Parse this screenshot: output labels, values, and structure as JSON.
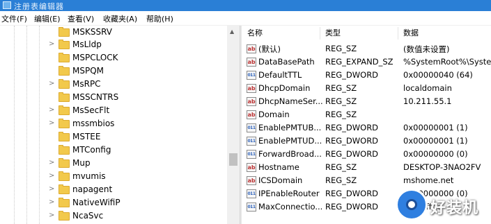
{
  "window": {
    "title": "注册表编辑器"
  },
  "menu": [
    "文件(F)",
    "编辑(E)",
    "查看(V)",
    "收藏夹(A)",
    "帮助(H)"
  ],
  "tree": [
    {
      "label": "MSKSSRV",
      "expandable": false
    },
    {
      "label": "MsLldp",
      "expandable": true
    },
    {
      "label": "MSPCLOCK",
      "expandable": false
    },
    {
      "label": "MSPQM",
      "expandable": false
    },
    {
      "label": "MsRPC",
      "expandable": true
    },
    {
      "label": "MSSCNTRS",
      "expandable": false
    },
    {
      "label": "MsSecFlt",
      "expandable": true
    },
    {
      "label": "mssmbios",
      "expandable": true
    },
    {
      "label": "MSTEE",
      "expandable": false
    },
    {
      "label": "MTConfig",
      "expandable": false
    },
    {
      "label": "Mup",
      "expandable": true
    },
    {
      "label": "mvumis",
      "expandable": true
    },
    {
      "label": "napagent",
      "expandable": true
    },
    {
      "label": "NativeWifiP",
      "expandable": true
    },
    {
      "label": "NcaSvc",
      "expandable": true
    }
  ],
  "list": {
    "columns": [
      "名称",
      "类型",
      "数据"
    ],
    "rows": [
      {
        "icon": "string-value-icon",
        "name": "(默认)",
        "type": "REG_SZ",
        "data": "(数值未设置)"
      },
      {
        "icon": "string-value-icon",
        "name": "DataBasePath",
        "type": "REG_EXPAND_SZ",
        "data": "%SystemRoot%\\System"
      },
      {
        "icon": "binary-value-icon",
        "name": "DefaultTTL",
        "type": "REG_DWORD",
        "data": "0x00000040 (64)"
      },
      {
        "icon": "string-value-icon",
        "name": "DhcpDomain",
        "type": "REG_SZ",
        "data": "localdomain"
      },
      {
        "icon": "string-value-icon",
        "name": "DhcpNameSer...",
        "type": "REG_SZ",
        "data": "10.211.55.1"
      },
      {
        "icon": "string-value-icon",
        "name": "Domain",
        "type": "REG_SZ",
        "data": ""
      },
      {
        "icon": "binary-value-icon",
        "name": "EnablePMTUB...",
        "type": "REG_DWORD",
        "data": "0x00000001 (1)"
      },
      {
        "icon": "binary-value-icon",
        "name": "EnablePMTUD...",
        "type": "REG_DWORD",
        "data": "0x00000001 (1)"
      },
      {
        "icon": "binary-value-icon",
        "name": "ForwardBroad...",
        "type": "REG_DWORD",
        "data": "0x00000000 (0)"
      },
      {
        "icon": "string-value-icon",
        "name": "Hostname",
        "type": "REG_SZ",
        "data": "DESKTOP-3NAO2FV"
      },
      {
        "icon": "string-value-icon",
        "name": "ICSDomain",
        "type": "REG_SZ",
        "data": "mshome.net"
      },
      {
        "icon": "binary-value-icon",
        "name": "IPEnableRouter",
        "type": "REG_DWORD",
        "data": "0x00000000 (0)"
      },
      {
        "icon": "binary-value-icon",
        "name": "MaxConnectio...",
        "type": "REG_DWORD",
        "data": "0x00fffffe"
      }
    ]
  },
  "watermark": {
    "text": "好装机"
  }
}
